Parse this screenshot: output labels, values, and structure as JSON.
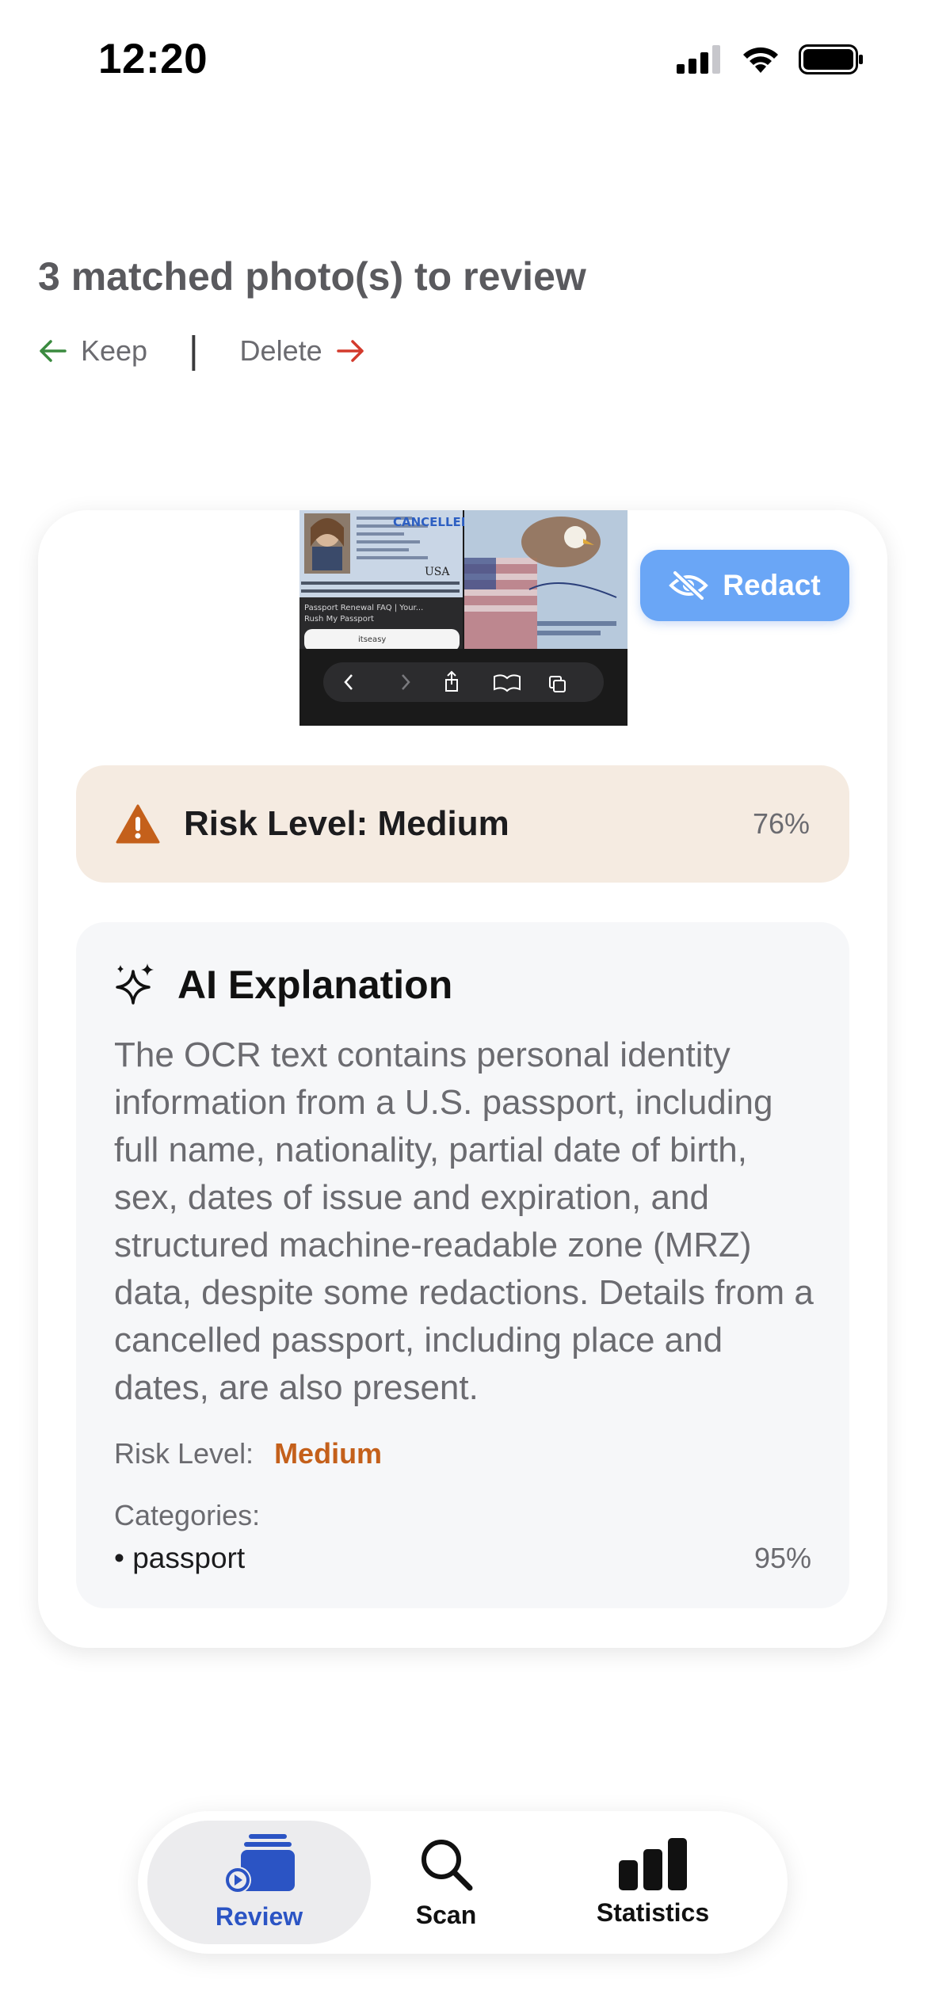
{
  "status_bar": {
    "time": "12:20"
  },
  "header": {
    "title": "3 matched photo(s) to review",
    "keep_label": "Keep",
    "separator": "|",
    "delete_label": "Delete"
  },
  "card": {
    "redact_label": "Redact",
    "thumbnail": {
      "stamp": "CANCELLED",
      "country": "USA",
      "caption_line1": "Passport Renewal FAQ | Your...",
      "caption_line2": "Rush My Passport",
      "site_logo": "itseasy"
    },
    "risk_banner": {
      "label": "Risk Level: Medium",
      "percent": "76%"
    },
    "ai": {
      "title": "AI Explanation",
      "body": "The OCR text contains personal identity information from a U.S. passport, including full name, nationality, partial date of birth, sex, dates of issue and expiration, and structured machine-readable zone (MRZ) data, despite some redactions. Details from a cancelled passport, including place and dates, are also present.",
      "risk_label": "Risk Level:",
      "risk_value": "Medium",
      "categories_label": "Categories:",
      "categories": [
        {
          "name": "• passport",
          "percent": "95%"
        }
      ]
    }
  },
  "tabbar": {
    "tabs": [
      {
        "label": "Review",
        "icon": "review-icon",
        "active": true
      },
      {
        "label": "Scan",
        "icon": "search-icon",
        "active": false
      },
      {
        "label": "Statistics",
        "icon": "bar-chart-icon",
        "active": false
      }
    ]
  },
  "colors": {
    "accent": "#2b54c4",
    "redact": "#6aa6f6",
    "risk_medium": "#c4601b",
    "keep": "#3a8a3f",
    "delete": "#d33a2c"
  }
}
